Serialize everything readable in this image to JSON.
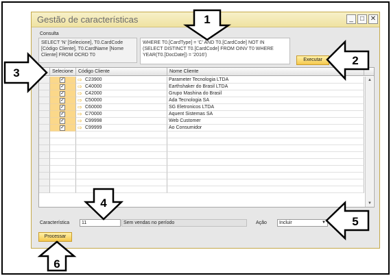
{
  "window": {
    "title": "Gestão de características",
    "minimize": "_",
    "maximize": "□",
    "close": "✕"
  },
  "query": {
    "label": "Consulta",
    "select_text": "SELECT 'N' [Selecione], T0.CardCode\n[Código Cliente], T0.CardName [Nome\nCliente] FROM OCRD T0",
    "where_text": "WHERE T0.[CardType] = 'C' AND T0.[CardCode] NOT IN\n(SELECT DISTINCT T0.[CardCode] FROM OINV T0 WHERE\nYEAR(T0.[DocDate]) = '2016')"
  },
  "buttons": {
    "execute": "Executar",
    "process": "Processar"
  },
  "grid": {
    "headers": [
      "Selecione",
      "Código Cliente",
      "Nome Cliente"
    ],
    "rows": [
      {
        "checked": "✓",
        "code": "C23900",
        "name": "Parameter Tecnologia LTDA"
      },
      {
        "checked": "✓",
        "code": "C40000",
        "name": "Earthshaker do Brasil LTDA"
      },
      {
        "checked": "✓",
        "code": "C42000",
        "name": "Grupo Mashina do Brasil"
      },
      {
        "checked": "✓",
        "code": "C50000",
        "name": "Ada Tecnologia SA"
      },
      {
        "checked": "✓",
        "code": "C60000",
        "name": "SG Eletronicos LTDA"
      },
      {
        "checked": "✓",
        "code": "C70000",
        "name": "Aquent Sistemas SA"
      },
      {
        "checked": "✓",
        "code": "C99998",
        "name": "Web Customer"
      },
      {
        "checked": "✓",
        "code": "C99999",
        "name": "Ao Consumidor"
      }
    ],
    "empty_rows": 9
  },
  "characteristic": {
    "label": "Característica",
    "value": "11",
    "description": "Sem vendas no período"
  },
  "action": {
    "label": "Ação",
    "value": "Incluir"
  },
  "callouts": [
    "1",
    "2",
    "3",
    "4",
    "5",
    "6"
  ],
  "icons": {
    "row_link": "arrow-right-icon",
    "dropdown": "chevron-down-icon"
  },
  "colors": {
    "title_bar": "#efe2a1",
    "selected_cell": "#fbd88a",
    "button": "#f5c84d",
    "link_arrow": "#e4a812"
  }
}
